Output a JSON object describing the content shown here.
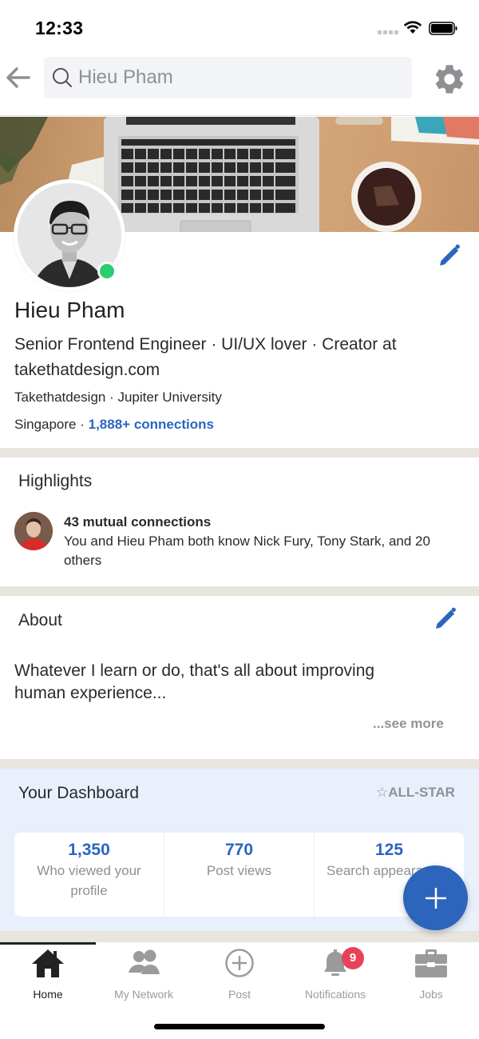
{
  "status_bar": {
    "time": "12:33"
  },
  "topnav": {
    "search_value": "Hieu Pham",
    "icons": {
      "back": "arrow-left-icon",
      "search": "search-icon",
      "settings": "gear-icon"
    }
  },
  "profile": {
    "name": "Hieu Pham",
    "headline": "Senior Frontend Engineer · UI/UX lover · Creator at takethatdesign.com",
    "company_school": "Takethatdesign · Jupiter University",
    "location": "Singapore · ",
    "connections": "1,888+ connections",
    "online": true,
    "colors": {
      "online": "#2ecc71",
      "accent": "#2a66c0"
    }
  },
  "highlights": {
    "title": "Highlights",
    "mutual_title": "43 mutual connections",
    "mutual_desc": "You and Hieu Pham both know Nick Fury, Tony Stark, and 20 others"
  },
  "about": {
    "title": "About",
    "text": "Whatever I learn or do, that's all about improving human experience...",
    "see_more": "...see more"
  },
  "dashboard": {
    "title": "Your Dashboard",
    "badge": "☆ALL-STAR",
    "stats": [
      {
        "value": "1,350",
        "label": "Who viewed your profile"
      },
      {
        "value": "770",
        "label": "Post views"
      },
      {
        "value": "125",
        "label": "Search appearances"
      }
    ]
  },
  "fab": {
    "label": "+"
  },
  "bottom_nav": {
    "items": [
      {
        "label": "Home",
        "icon": "home-icon",
        "active": true
      },
      {
        "label": "My Network",
        "icon": "people-icon"
      },
      {
        "label": "Post",
        "icon": "plus-circle-icon"
      },
      {
        "label": "Notifications",
        "icon": "bell-icon",
        "badge": "9"
      },
      {
        "label": "Jobs",
        "icon": "briefcase-icon"
      }
    ],
    "colors": {
      "badge": "#e5435a",
      "active": "#222222",
      "inactive": "#9b9b9b"
    }
  }
}
